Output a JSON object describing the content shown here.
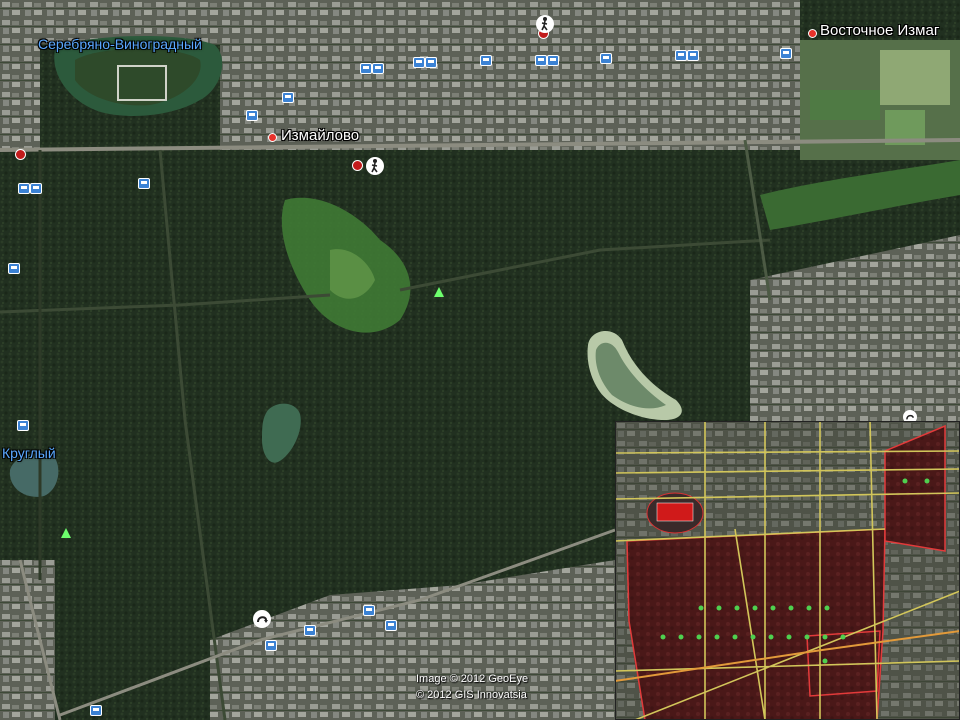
{
  "places": {
    "serebryano": "Серебряно-Виноградный",
    "vostochnoe": "Восточное Измаг",
    "izmaylovo": "Измайлово",
    "krugly": "Круглый"
  },
  "attribution": {
    "line1": "Image © 2012 GeoEye",
    "line2": "© 2012 GIS Innovatsia"
  },
  "colors": {
    "forest": "#223220",
    "urban": "#5b5e54",
    "inset_zone": "#5a1c1c"
  },
  "icons": [
    "bus-stop-icon",
    "metro-icon",
    "pedestrian-icon",
    "tree-icon",
    "parking-icon"
  ]
}
